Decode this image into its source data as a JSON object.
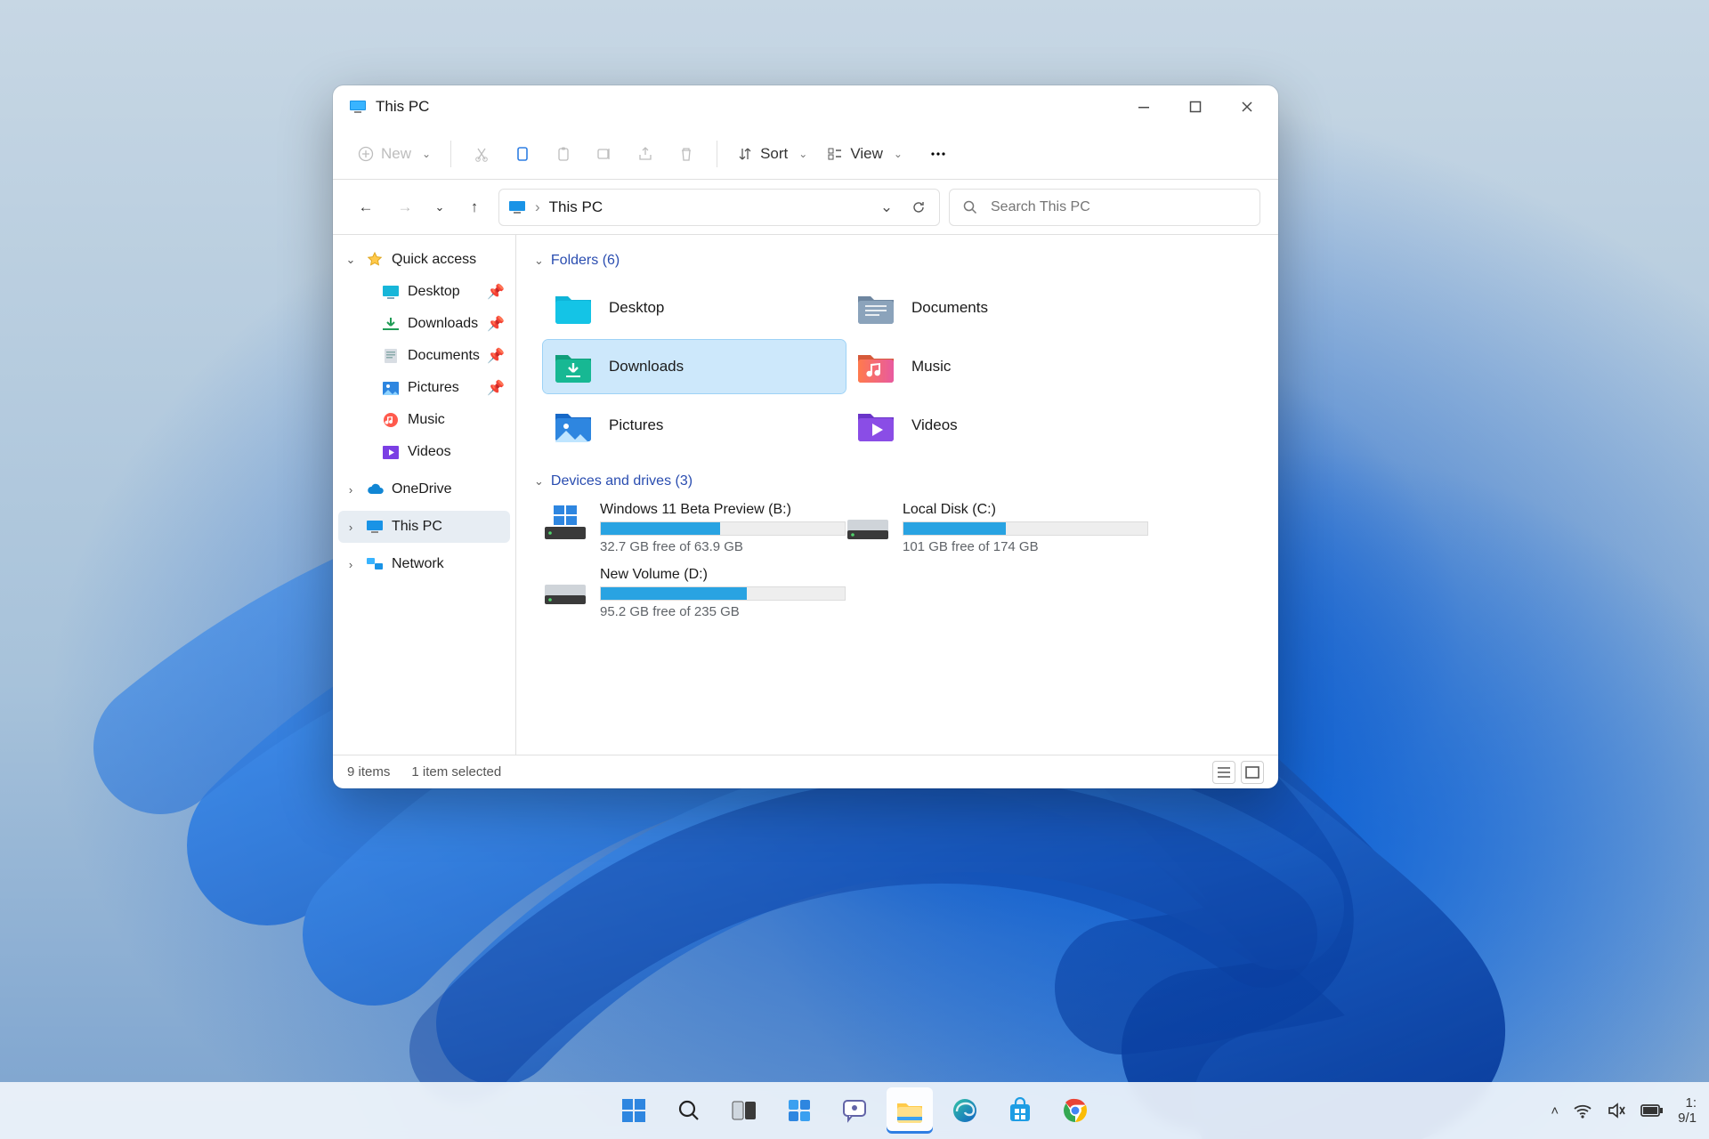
{
  "window": {
    "title": "This PC",
    "toolbar": {
      "new": "New",
      "sort": "Sort",
      "view": "View"
    },
    "breadcrumb": {
      "root": "This PC"
    },
    "search": {
      "placeholder": "Search This PC"
    },
    "sidebar": {
      "quick_access_label": "Quick access",
      "quick_access": [
        {
          "label": "Desktop"
        },
        {
          "label": "Downloads"
        },
        {
          "label": "Documents"
        },
        {
          "label": "Pictures"
        },
        {
          "label": "Music"
        },
        {
          "label": "Videos"
        }
      ],
      "onedrive": "OneDrive",
      "thispc": "This PC",
      "network": "Network"
    },
    "sections": {
      "folders_label": "Folders (6)",
      "drives_label": "Devices and drives (3)"
    },
    "folders": [
      {
        "label": "Desktop"
      },
      {
        "label": "Documents"
      },
      {
        "label": "Downloads",
        "selected": true
      },
      {
        "label": "Music"
      },
      {
        "label": "Pictures"
      },
      {
        "label": "Videos"
      }
    ],
    "drives": [
      {
        "name": "Windows 11 Beta Preview (B:)",
        "free": "32.7 GB free of 63.9 GB",
        "used_pct": 49
      },
      {
        "name": "Local Disk (C:)",
        "free": "101 GB free of 174 GB",
        "used_pct": 42
      },
      {
        "name": "New Volume (D:)",
        "free": "95.2 GB free of 235 GB",
        "used_pct": 60
      }
    ],
    "status": {
      "items": "9 items",
      "selected": "1 item selected"
    }
  },
  "taskbar": {
    "time": "1:",
    "date": "9/1"
  }
}
